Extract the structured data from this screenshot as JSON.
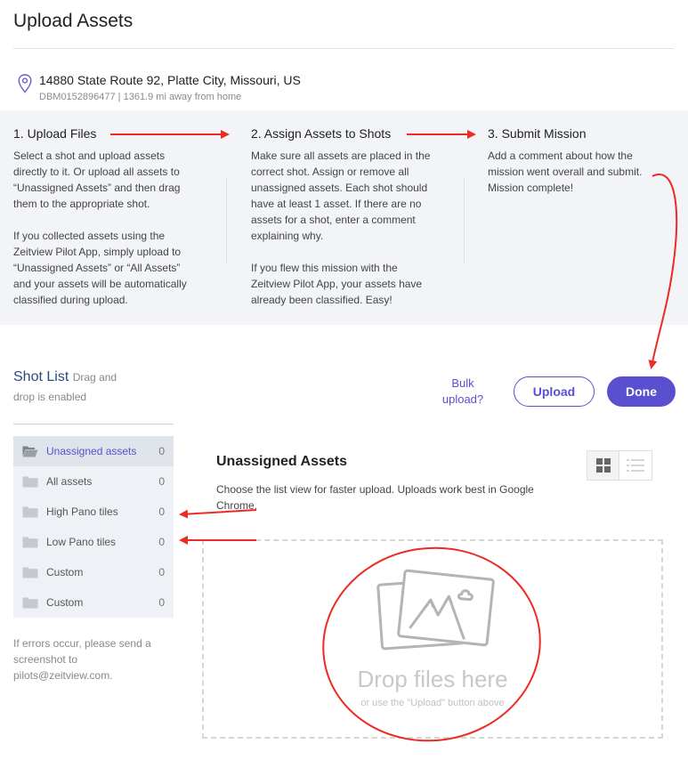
{
  "page": {
    "title": "Upload Assets"
  },
  "location": {
    "address": "14880 State Route 92, Platte City, Missouri, US",
    "meta": "DBM0152896477 | 1361.9 mi away from home",
    "icon": "map-pin-icon"
  },
  "steps": [
    {
      "title": "1. Upload Files",
      "paragraphs": [
        "Select a shot and upload assets directly to it. Or upload all assets to “Unassigned Assets” and then drag them to the appropriate shot.",
        "If you collected assets using the Zeitview Pilot App, simply upload to “Unassigned Assets” or “All Assets” and your assets will be automatically classified during upload."
      ]
    },
    {
      "title": "2. Assign Assets to Shots",
      "paragraphs": [
        "Make sure all assets are placed in the correct shot. Assign or remove all unassigned assets. Each shot should have at least 1 asset. If there are no assets for a shot, enter a comment explaining why.",
        "If you flew this mission with the Zeitview Pilot App, your assets have already been classified. Easy!"
      ]
    },
    {
      "title": "3. Submit Mission",
      "paragraphs": [
        "Add a comment about how the mission went overall and submit. Mission complete!"
      ]
    }
  ],
  "shot_list": {
    "title": "Shot List",
    "hint": "Drag and drop is enabled",
    "items": [
      {
        "label": "Unassigned assets",
        "count": "0",
        "active": true
      },
      {
        "label": "All assets",
        "count": "0"
      },
      {
        "label": "High Pano tiles",
        "count": "0"
      },
      {
        "label": "Low Pano tiles",
        "count": "0"
      },
      {
        "label": "Custom",
        "count": "0"
      },
      {
        "label": "Custom",
        "count": "0"
      }
    ],
    "errors_note": "If errors occur, please send a screenshot to pilots@zeitview.com."
  },
  "actions": {
    "bulk_upload": "Bulk upload?",
    "upload": "Upload",
    "done": "Done"
  },
  "assets": {
    "title": "Unassigned Assets",
    "description": "Choose the list view for faster upload. Uploads work best in Google Chrome.",
    "drop_text": "Drop files here",
    "drop_sub": "or use the \"Upload\" button above"
  },
  "colors": {
    "accent": "#5a4fcf",
    "annotation": "#ee2a24",
    "steps_bg": "#f2f4f7"
  }
}
